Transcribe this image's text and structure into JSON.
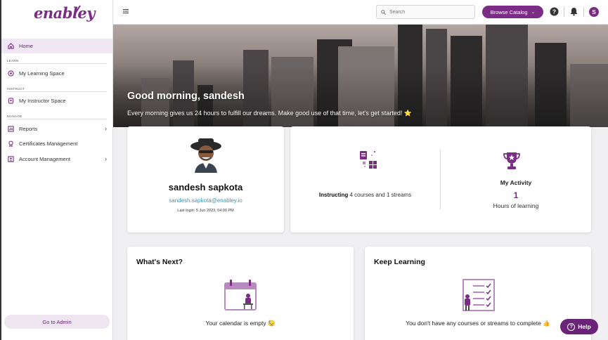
{
  "brand": {
    "name": "enabley",
    "accent": "#7b2d86"
  },
  "sidebar": {
    "home": {
      "label": "Home",
      "icon": "home-icon"
    },
    "sections": [
      {
        "label": "LEARN"
      },
      {
        "label": "INSTRUCT"
      },
      {
        "label": "MANAGE"
      }
    ],
    "items": [
      {
        "label": "My Learning Space",
        "icon": "learning-space-icon"
      },
      {
        "label": "My Instructor Space",
        "icon": "instructor-icon"
      },
      {
        "label": "Reports",
        "icon": "reports-icon",
        "has_submenu": true
      },
      {
        "label": "Certificates Management",
        "icon": "certificate-icon"
      },
      {
        "label": "Account Management",
        "icon": "account-icon",
        "has_submenu": true
      }
    ],
    "admin_button": "Go to Admin"
  },
  "header": {
    "search_placeholder": "Search",
    "browse_label": "Browse Catalog",
    "avatar_initial": "S"
  },
  "hero": {
    "greeting": "Good morning, sandesh",
    "motto": "Every morning gives us 24 hours to fulfill our dreams. Make good use of that time, let's get started! ⭐"
  },
  "profile": {
    "name": "sandesh sapkota",
    "email": "sandesh.sapkota@enabley.io",
    "last_login": "Last login: 5 Jun 2023, 04:00 PM"
  },
  "stats": {
    "instructing_bold": "Instructing",
    "instructing_rest": " 4 courses and 1 streams",
    "activity_title": "My Activity",
    "activity_value": "1",
    "activity_label": "Hours of learning"
  },
  "whats_next": {
    "title": "What's Next?",
    "message": "Your calendar is empty 😓"
  },
  "keep_learning": {
    "title": "Keep Learning",
    "message": "You don't have any courses or streams to complete 👍"
  },
  "help_label": "Help"
}
